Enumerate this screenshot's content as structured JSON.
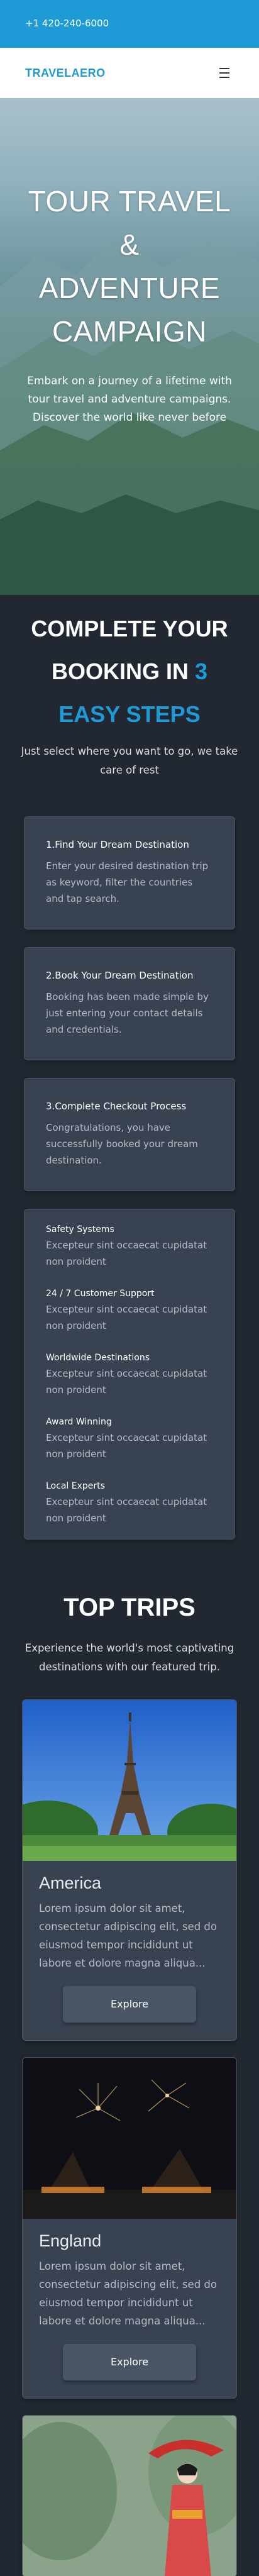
{
  "topbar": {
    "phone": "+1 420-240-6000"
  },
  "navbar": {
    "logo": "TRAVELAERO"
  },
  "hero": {
    "title_lines": [
      "TOUR TRAVEL",
      "&",
      "ADVENTURE",
      "CAMPAIGN"
    ],
    "description": "Embark on a journey of a lifetime with tour travel and adventure campaigns. Discover the world like never before"
  },
  "steps": {
    "title_part1": "COMPLETE YOUR BOOKING IN ",
    "title_accent": "3 EASY STEPS",
    "subtitle": "Just select where you want to go, we take care of rest",
    "cards": [
      {
        "title": "1.Find Your Dream Destination",
        "text": "Enter your desired destination trip as keyword, filter the countries and tap search."
      },
      {
        "title": "2.Book Your Dream Destination",
        "text": "Booking has been made simple by just entering your contact details and credentials."
      },
      {
        "title": "3.Complete Checkout Process",
        "text": "Congratulations, you have successfully booked your dream destination."
      }
    ],
    "features": [
      {
        "title": "Safety Systems",
        "text": "Excepteur sint occaecat cupidatat non proident"
      },
      {
        "title": "24 / 7 Customer Support",
        "text": "Excepteur sint occaecat cupidatat non proident"
      },
      {
        "title": "Worldwide Destinations",
        "text": "Excepteur sint occaecat cupidatat non proident"
      },
      {
        "title": "Award Winning",
        "text": "Excepteur sint occaecat cupidatat non proident"
      },
      {
        "title": "Local Experts",
        "text": "Excepteur sint occaecat cupidatat non proident"
      }
    ]
  },
  "trips": {
    "title": "TOP TRIPS",
    "subtitle": "Experience the world's most captivating destinations with our featured trip.",
    "items": [
      {
        "name": "America",
        "text": "Lorem ipsum dolor sit amet, consectetur adipiscing elit, sed do eiusmod tempor incididunt ut labore et dolore magna aliqua...",
        "button": "Explore"
      },
      {
        "name": "England",
        "text": "Lorem ipsum dolor sit amet, consectetur adipiscing elit, sed do eiusmod tempor incididunt ut labore et dolore magna aliqua...",
        "button": "Explore"
      }
    ]
  },
  "colors": {
    "accent": "#1e9ad6",
    "background": "#222831",
    "card": "#394250"
  }
}
